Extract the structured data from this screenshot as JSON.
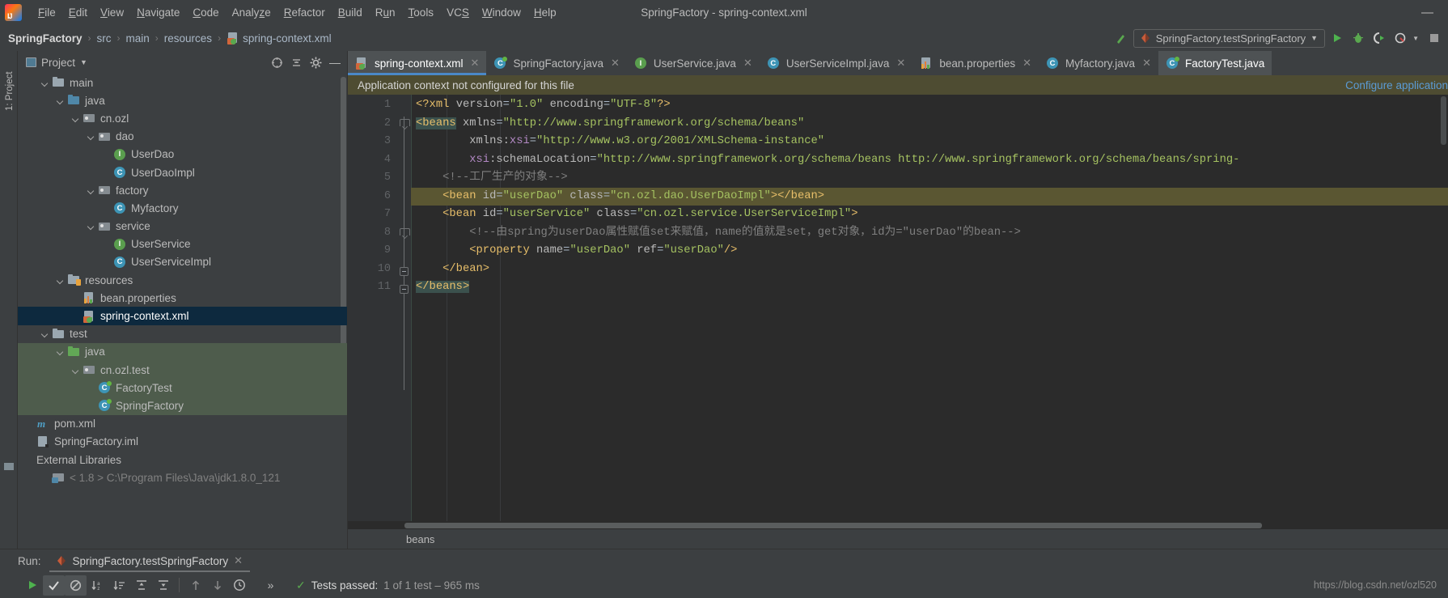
{
  "window": {
    "title": "SpringFactory - spring-context.xml",
    "logo_icon": "intellij-idea-logo",
    "minimize_label": "—"
  },
  "menubar": {
    "items": [
      {
        "label": "File",
        "mnemonic": "F"
      },
      {
        "label": "Edit",
        "mnemonic": "E"
      },
      {
        "label": "View",
        "mnemonic": "V"
      },
      {
        "label": "Navigate",
        "mnemonic": "N"
      },
      {
        "label": "Code",
        "mnemonic": "C"
      },
      {
        "label": "Analyze",
        "mnemonic": "z"
      },
      {
        "label": "Refactor",
        "mnemonic": "R"
      },
      {
        "label": "Build",
        "mnemonic": "B"
      },
      {
        "label": "Run",
        "mnemonic": "u"
      },
      {
        "label": "Tools",
        "mnemonic": "T"
      },
      {
        "label": "VCS",
        "mnemonic": "S"
      },
      {
        "label": "Window",
        "mnemonic": "W"
      },
      {
        "label": "Help",
        "mnemonic": "H"
      }
    ]
  },
  "breadcrumb": {
    "separator": "›",
    "items": [
      "SpringFactory",
      "src",
      "main",
      "resources",
      "spring-context.xml"
    ],
    "file_icon": "xml-spring-file-icon"
  },
  "toolbar": {
    "build_icon": "build-hammer-icon",
    "run_config": "SpringFactory.testSpringFactory",
    "run_config_dropdown_icon": "chevron-down-icon",
    "run_icon": "run-play-icon",
    "debug_icon": "debug-bug-icon",
    "run_coverage_icon": "run-with-coverage-icon",
    "profile_icon": "profiler-icon",
    "profile_dropdown_icon": "chevron-down-icon",
    "stop_icon": "stop-square-icon"
  },
  "left_strip": {
    "project_tab": "1: Project"
  },
  "project_panel": {
    "title": "Project",
    "title_dropdown_icon": "chevron-down-icon",
    "locate_icon": "locate-target-icon",
    "collapse_icon": "collapse-all-icon",
    "settings_icon": "gear-icon",
    "hide_icon": "minimize-icon",
    "tree": [
      {
        "label": "main",
        "indent": 1,
        "icon": "folder-icon",
        "expand": true,
        "selected": false,
        "test": false
      },
      {
        "label": "java",
        "indent": 2,
        "icon": "folder-source-icon",
        "expand": true,
        "selected": false,
        "test": false
      },
      {
        "label": "cn.ozl",
        "indent": 3,
        "icon": "package-icon",
        "expand": true,
        "selected": false,
        "test": false
      },
      {
        "label": "dao",
        "indent": 4,
        "icon": "package-icon",
        "expand": true,
        "selected": false,
        "test": false
      },
      {
        "label": "UserDao",
        "indent": 5,
        "icon": "interface-icon",
        "expand": false,
        "selected": false,
        "test": false
      },
      {
        "label": "UserDaoImpl",
        "indent": 5,
        "icon": "class-icon",
        "expand": false,
        "selected": false,
        "test": false
      },
      {
        "label": "factory",
        "indent": 4,
        "icon": "package-icon",
        "expand": true,
        "selected": false,
        "test": false
      },
      {
        "label": "Myfactory",
        "indent": 5,
        "icon": "class-icon",
        "expand": false,
        "selected": false,
        "test": false
      },
      {
        "label": "service",
        "indent": 4,
        "icon": "package-icon",
        "expand": true,
        "selected": false,
        "test": false
      },
      {
        "label": "UserService",
        "indent": 5,
        "icon": "interface-icon",
        "expand": false,
        "selected": false,
        "test": false
      },
      {
        "label": "UserServiceImpl",
        "indent": 5,
        "icon": "class-icon",
        "expand": false,
        "selected": false,
        "test": false
      },
      {
        "label": "resources",
        "indent": 2,
        "icon": "folder-resources-icon",
        "expand": true,
        "selected": false,
        "test": false
      },
      {
        "label": "bean.properties",
        "indent": 3,
        "icon": "properties-file-icon",
        "expand": false,
        "selected": false,
        "test": false
      },
      {
        "label": "spring-context.xml",
        "indent": 3,
        "icon": "xml-spring-file-icon",
        "expand": false,
        "selected": true,
        "test": false
      },
      {
        "label": "test",
        "indent": 1,
        "icon": "folder-icon",
        "expand": true,
        "selected": false,
        "test": false
      },
      {
        "label": "java",
        "indent": 2,
        "icon": "folder-test-icon",
        "expand": true,
        "selected": false,
        "test": true
      },
      {
        "label": "cn.ozl.test",
        "indent": 3,
        "icon": "package-icon",
        "expand": true,
        "selected": false,
        "test": true
      },
      {
        "label": "FactoryTest",
        "indent": 4,
        "icon": "test-class-icon",
        "expand": false,
        "selected": false,
        "test": true
      },
      {
        "label": "SpringFactory",
        "indent": 4,
        "icon": "test-class-icon",
        "expand": false,
        "selected": false,
        "test": true
      },
      {
        "label": "pom.xml",
        "indent": 0,
        "icon": "maven-pom-icon",
        "expand": false,
        "selected": false,
        "test": false
      },
      {
        "label": "SpringFactory.iml",
        "indent": 0,
        "icon": "iml-module-icon",
        "expand": false,
        "selected": false,
        "test": false
      },
      {
        "label": "External Libraries",
        "indent": 0,
        "icon": "none",
        "expand": false,
        "selected": false,
        "test": false
      },
      {
        "label": "< 1.8 >  C:\\Program Files\\Java\\jdk1.8.0_121",
        "indent": 1,
        "icon": "library-icon",
        "expand": false,
        "selected": false,
        "test": false,
        "dim": true
      }
    ]
  },
  "editor_tabs": [
    {
      "label": "spring-context.xml",
      "icon": "xml-spring-file-icon",
      "active": true,
      "close_icon": "close-icon"
    },
    {
      "label": "SpringFactory.java",
      "icon": "test-class-icon",
      "active": false,
      "close_icon": "close-icon"
    },
    {
      "label": "UserService.java",
      "icon": "interface-icon",
      "active": false,
      "close_icon": "close-icon"
    },
    {
      "label": "UserServiceImpl.java",
      "icon": "class-icon",
      "active": false,
      "close_icon": "close-icon"
    },
    {
      "label": "bean.properties",
      "icon": "properties-file-icon",
      "active": false,
      "close_icon": "close-icon"
    },
    {
      "label": "Myfactory.java",
      "icon": "class-icon",
      "active": false,
      "close_icon": "close-icon"
    },
    {
      "label": "FactoryTest.java",
      "icon": "test-class-icon",
      "active": false,
      "close_icon": "none"
    }
  ],
  "notification_bar": {
    "message": "Application context not configured for this file",
    "action": "Configure application"
  },
  "editor": {
    "line_numbers": [
      "1",
      "2",
      "3",
      "4",
      "5",
      "6",
      "7",
      "8",
      "9",
      "10",
      "11"
    ],
    "lines": [
      {
        "n": 1,
        "highlight": false,
        "tokens": [
          {
            "t": "<?xml ",
            "c": "t-proc"
          },
          {
            "t": "version",
            "c": "t-attr"
          },
          {
            "t": "=",
            "c": "t-punc"
          },
          {
            "t": "\"1.0\"",
            "c": "t-str"
          },
          {
            "t": " encoding",
            "c": "t-attr"
          },
          {
            "t": "=",
            "c": "t-punc"
          },
          {
            "t": "\"UTF-8\"",
            "c": "t-str"
          },
          {
            "t": "?>",
            "c": "t-proc"
          }
        ]
      },
      {
        "n": 2,
        "highlight": false,
        "tokens": [
          {
            "t": "<beans",
            "c": "t-tag brmatch"
          },
          {
            "t": " xmlns",
            "c": "t-attr"
          },
          {
            "t": "=",
            "c": "t-punc"
          },
          {
            "t": "\"http://www.springframework.org/schema/beans\"",
            "c": "t-str"
          }
        ]
      },
      {
        "n": 3,
        "highlight": false,
        "tokens": [
          {
            "t": "        xmlns:",
            "c": "t-attr"
          },
          {
            "t": "xsi",
            "c": "t-ns"
          },
          {
            "t": "=",
            "c": "t-punc"
          },
          {
            "t": "\"http://www.w3.org/2001/XMLSchema-instance\"",
            "c": "t-str"
          }
        ]
      },
      {
        "n": 4,
        "highlight": false,
        "tokens": [
          {
            "t": "        ",
            "c": "t-attr"
          },
          {
            "t": "xsi",
            "c": "t-ns"
          },
          {
            "t": ":schemaLocation",
            "c": "t-attr"
          },
          {
            "t": "=",
            "c": "t-punc"
          },
          {
            "t": "\"http://www.springframework.org/schema/beans http://www.springframework.org/schema/beans/spring-",
            "c": "t-str"
          }
        ]
      },
      {
        "n": 5,
        "highlight": false,
        "tokens": [
          {
            "t": "    <!--工厂生产的对象-->",
            "c": "t-comment"
          }
        ]
      },
      {
        "n": 6,
        "highlight": true,
        "tokens": [
          {
            "t": "    <bean",
            "c": "t-tag"
          },
          {
            "t": " id",
            "c": "t-attr"
          },
          {
            "t": "=",
            "c": "t-punc"
          },
          {
            "t": "\"userDao\"",
            "c": "t-str"
          },
          {
            "t": " class",
            "c": "t-attr"
          },
          {
            "t": "=",
            "c": "t-punc"
          },
          {
            "t": "\"cn.ozl.dao.UserDaoImpl\"",
            "c": "t-str"
          },
          {
            "t": ">",
            "c": "t-tag"
          },
          {
            "t": "</bean>",
            "c": "t-tag"
          }
        ]
      },
      {
        "n": 7,
        "highlight": false,
        "tokens": [
          {
            "t": "    <bean",
            "c": "t-tag"
          },
          {
            "t": " id",
            "c": "t-attr"
          },
          {
            "t": "=",
            "c": "t-punc"
          },
          {
            "t": "\"userService\"",
            "c": "t-str"
          },
          {
            "t": " class",
            "c": "t-attr"
          },
          {
            "t": "=",
            "c": "t-punc"
          },
          {
            "t": "\"cn.ozl.service.UserServiceImpl\"",
            "c": "t-str"
          },
          {
            "t": ">",
            "c": "t-tag"
          }
        ]
      },
      {
        "n": 8,
        "highlight": false,
        "tokens": [
          {
            "t": "        <!--由spring为userDao属性赋值set来赋值，name的值就是set，get对象，id为=\"userDao\"的bean-->",
            "c": "t-comment"
          }
        ]
      },
      {
        "n": 9,
        "highlight": false,
        "tokens": [
          {
            "t": "        <property",
            "c": "t-tag"
          },
          {
            "t": " name",
            "c": "t-attr"
          },
          {
            "t": "=",
            "c": "t-punc"
          },
          {
            "t": "\"userDao\"",
            "c": "t-str"
          },
          {
            "t": " ref",
            "c": "t-attr"
          },
          {
            "t": "=",
            "c": "t-punc"
          },
          {
            "t": "\"userDao\"",
            "c": "t-str"
          },
          {
            "t": "/>",
            "c": "t-tag"
          }
        ]
      },
      {
        "n": 10,
        "highlight": false,
        "bulb": true,
        "tokens": [
          {
            "t": "    </bean>",
            "c": "t-tag"
          }
        ]
      },
      {
        "n": 11,
        "highlight": false,
        "tokens": [
          {
            "t": "</beans>",
            "c": "t-tag brmatch"
          }
        ]
      }
    ],
    "status_breadcrumb": "beans"
  },
  "run_panel": {
    "label": "Run:",
    "tab": "SpringFactory.testSpringFactory",
    "tab_icon": "junit-run-icon",
    "close_icon": "close-icon",
    "toolbar_icons": [
      "rerun-play-icon",
      "show-passed-check-icon",
      "hide-ignored-icon",
      "sort-alphabetically-icon",
      "sort-by-duration-icon",
      "expand-all-icon",
      "collapse-all-icon",
      "prev-failed-icon",
      "next-failed-icon",
      "history-clock-icon",
      "more-chevron-icon"
    ],
    "status_check_icon": "check-icon",
    "status_label": "Tests passed:",
    "status_detail": "1 of 1 test – 965 ms"
  },
  "watermark": "https://blog.csdn.net/ozl520",
  "colors": {
    "panel_bg": "#3c3f41",
    "editor_bg": "#2b2b2b",
    "gutter_bg": "#313335",
    "selection": "#0d293e",
    "test_scope": "#4e5c4c",
    "notification_bar": "#4e4c32",
    "line_highlight": "#5a5632",
    "accent_blue": "#4a88c7",
    "link_blue": "#5b9bd5",
    "green": "#5aa84f",
    "string_green": "#a5c261",
    "tag_yellow": "#e8bf6a"
  }
}
